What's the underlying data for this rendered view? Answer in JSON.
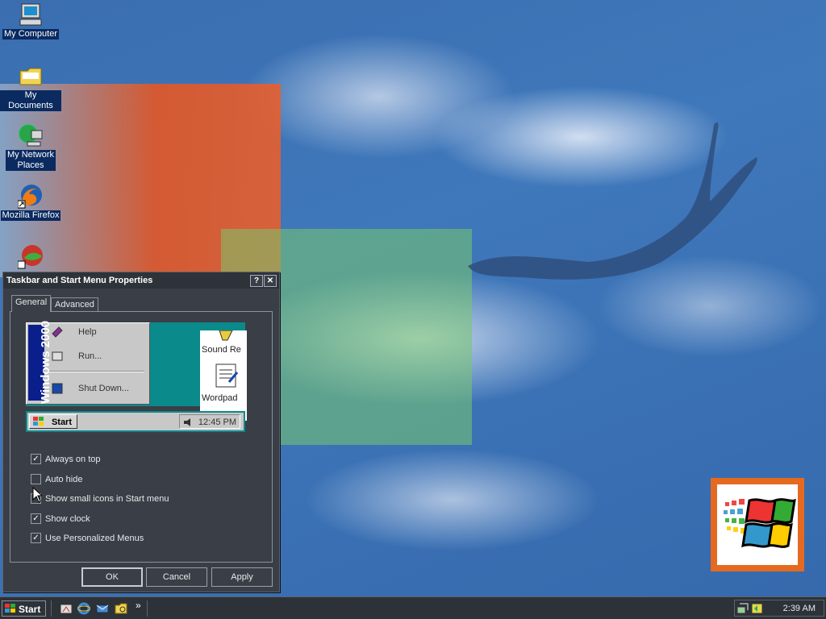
{
  "desktop": {
    "icons": [
      {
        "name": "my-computer",
        "label": "My Computer"
      },
      {
        "name": "my-documents",
        "label": "My Documents"
      },
      {
        "name": "my-network-places",
        "label": "My Network\nPlaces"
      },
      {
        "name": "mozilla-firefox",
        "label": "Mozilla Firefox"
      },
      {
        "name": "unnamed-shortcut",
        "label": ""
      }
    ]
  },
  "dialog": {
    "title": "Taskbar and Start Menu Properties",
    "help_btn": "?",
    "close_btn": "✕",
    "tabs": [
      {
        "label": "General",
        "selected": true
      },
      {
        "label": "Advanced",
        "selected": false
      }
    ],
    "preview": {
      "stripe_text": "Windows 2000",
      "menu_items": [
        "Help",
        "Run...",
        "Shut Down..."
      ],
      "window_items": [
        "Sound Re",
        "Wordpad"
      ],
      "start_label": "Start",
      "clock": "12:45 PM"
    },
    "options": [
      {
        "label": "Always on top",
        "checked": true
      },
      {
        "label": "Auto hide",
        "checked": false
      },
      {
        "label": "Show small icons in Start menu",
        "checked": false
      },
      {
        "label": "Show clock",
        "checked": true
      },
      {
        "label": "Use Personalized Menus",
        "checked": true
      }
    ],
    "buttons": {
      "ok": "OK",
      "cancel": "Cancel",
      "apply": "Apply"
    }
  },
  "taskbar": {
    "start_label": "Start",
    "quick_launch": [
      "show-desktop-icon",
      "internet-explorer-icon",
      "outlook-express-icon",
      "explorer-icon"
    ],
    "chevron": "»",
    "clock": "2:39 AM"
  },
  "colors": {
    "wallpaper_blue": "#3f78bb",
    "dialog_bg": "#3a3f47",
    "taskbar_bg": "#2d3238",
    "logo_orange": "#e56a1f"
  }
}
